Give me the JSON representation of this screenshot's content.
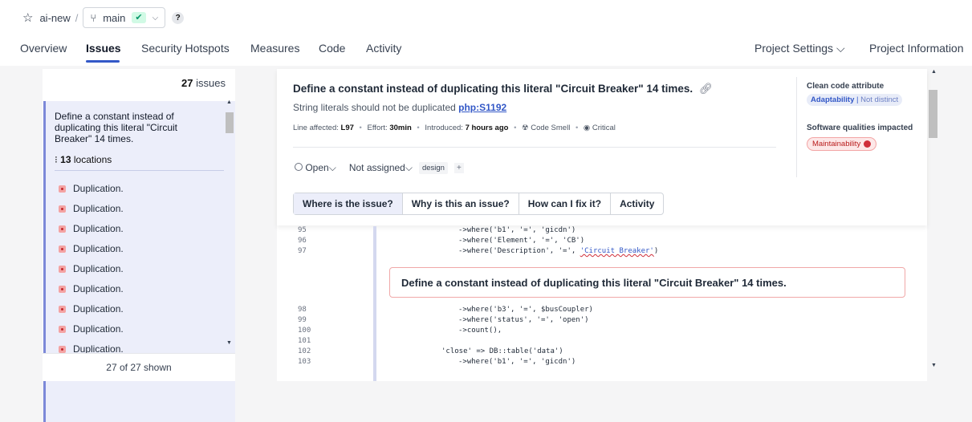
{
  "breadcrumb": {
    "project": "ai-new",
    "separator": "/",
    "branch": "main",
    "branch_status": "✔",
    "help": "?"
  },
  "tabs": [
    {
      "label": "Overview"
    },
    {
      "label": "Issues"
    },
    {
      "label": "Security Hotspots"
    },
    {
      "label": "Measures"
    },
    {
      "label": "Code"
    },
    {
      "label": "Activity"
    }
  ],
  "tabs_right": {
    "settings": "Project Settings ⌵",
    "information": "Project Information"
  },
  "left": {
    "count_number": "27",
    "count_label": "issues",
    "selected_issue": {
      "title": "Define a constant instead of duplicating this literal \"Circuit Breaker\" 14 times.",
      "locations_count": "13",
      "locations_label": "locations"
    },
    "locations": [
      "Duplication.",
      "Duplication.",
      "Duplication.",
      "Duplication.",
      "Duplication.",
      "Duplication.",
      "Duplication.",
      "Duplication.",
      "Duplication."
    ],
    "shown": "27 of 27 shown"
  },
  "issue": {
    "title": "Define a constant instead of duplicating this literal \"Circuit Breaker\" 14 times.",
    "rule_text": "String literals should not be duplicated",
    "rule_key": "php:S1192",
    "meta": {
      "line_label": "Line affected:",
      "line_value": "L97",
      "effort_label": "Effort:",
      "effort_value": "30min",
      "introduced_label": "Introduced:",
      "introduced_value": "7 hours ago",
      "type": "Code Smell",
      "severity": "Critical"
    },
    "status": "Open",
    "assignee": "Not assigned",
    "tag": "design",
    "add_tag": "+",
    "subtabs": [
      "Where is the issue?",
      "Why is this an issue?",
      "How can I fix it?",
      "Activity"
    ],
    "clean_code_label": "Clean code attribute",
    "clean_code_value": "Adaptability",
    "clean_code_detail": "Not distinct",
    "qualities_label": "Software qualities impacted",
    "quality": "Maintainability"
  },
  "code": {
    "lines_before": [
      {
        "n": "95",
        "text": "->where('b1', '=', 'gicdn')"
      },
      {
        "n": "96",
        "text": "->where('Element', '=', 'CB')"
      },
      {
        "n": "97",
        "text_pre": "->where('Description', '=', ",
        "highlight": "'Circuit Breaker'",
        "text_post": ")"
      }
    ],
    "message": "Define a constant instead of duplicating this literal \"Circuit Breaker\" 14 times.",
    "lines_after": [
      {
        "n": "98",
        "text": "->where('b3', '=', $busCoupler)"
      },
      {
        "n": "99",
        "text": "->where('status', '=', 'open')"
      },
      {
        "n": "100",
        "text": "->count(),"
      },
      {
        "n": "101",
        "text": ""
      },
      {
        "n": "102",
        "text": "'close' => DB::table('data')"
      },
      {
        "n": "103",
        "text": "->where('b1', '=', 'gicdn')"
      }
    ]
  },
  "colors": {
    "accent": "#3358c7",
    "selected_bg": "#eceefa",
    "issue_red": "#d02f3a"
  }
}
